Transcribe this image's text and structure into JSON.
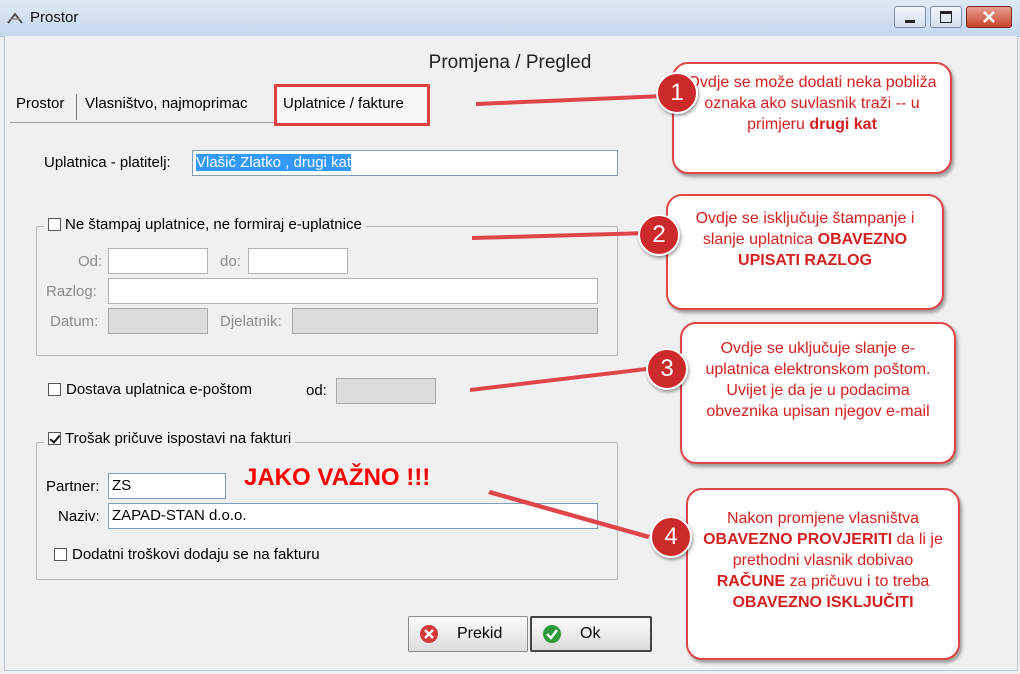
{
  "window": {
    "title": "Prostor",
    "heading": "Promjena / Pregled"
  },
  "tabs": [
    {
      "label": "Prostor"
    },
    {
      "label": "Vlasništvo, najmoprimac"
    },
    {
      "label": "Uplatnice / fakture"
    }
  ],
  "form": {
    "payer_label": "Uplatnica - platitelj:",
    "payer_value": "Vlašić Zlatko , drugi kat",
    "no_print_group": {
      "title": "Ne štampaj uplatnice, ne formiraj e-uplatnice",
      "checked": false,
      "from_label": "Od:",
      "to_label": "do:",
      "reason_label": "Razlog:",
      "date_label": "Datum:",
      "employee_label": "Djelatnik:"
    },
    "email_delivery": {
      "label": "Dostava uplatnica e-poštom",
      "checked": false,
      "from_label": "od:"
    },
    "invoice_group": {
      "title": "Trošak pričuve ispostavi na fakturi",
      "checked": true,
      "partner_label": "Partner:",
      "partner_value": "ZS",
      "name_label": "Naziv:",
      "name_value": "ZAPAD-STAN d.o.o.",
      "extra_costs_label": "Dodatni troškovi dodaju se na fakturu",
      "extra_costs_checked": false
    }
  },
  "buttons": {
    "cancel": "Prekid",
    "ok": "Ok"
  },
  "annotations": {
    "important": "JAKO VAŽNO !!!",
    "callouts": [
      {
        "number": "1",
        "text": "Ovdje se može dodati neka pobliža oznaka ako suvlasnik traži -- u primjeru ",
        "bold": "drugi kat"
      },
      {
        "number": "2",
        "text": "Ovdje se isključuje štampanje i slanje uplatnica ",
        "bold": "OBAVEZNO UPISATI RAZLOG"
      },
      {
        "number": "3",
        "text": "Ovdje se uključuje slanje e-uplatnica elektronskom poštom. Uvijet je da je u podacima obveznika upisan njegov e-mail",
        "bold": ""
      },
      {
        "number": "4",
        "text_a": "Nakon promjene vlasništva ",
        "bold_a": "OBAVEZNO PROVJERITI",
        "text_b": " da li je prethodni vlasnik dobivao ",
        "bold_b": "RAČUNE",
        "text_c": " za pričuvu i to treba ",
        "bold_c": "OBAVEZNO ISKLJUČITI"
      }
    ]
  },
  "colors": {
    "callout_border": "#e0454a",
    "callout_text": "#d42020",
    "badge": "#cc2a2a",
    "important": "#ff0000",
    "selection": "#3399ff"
  }
}
